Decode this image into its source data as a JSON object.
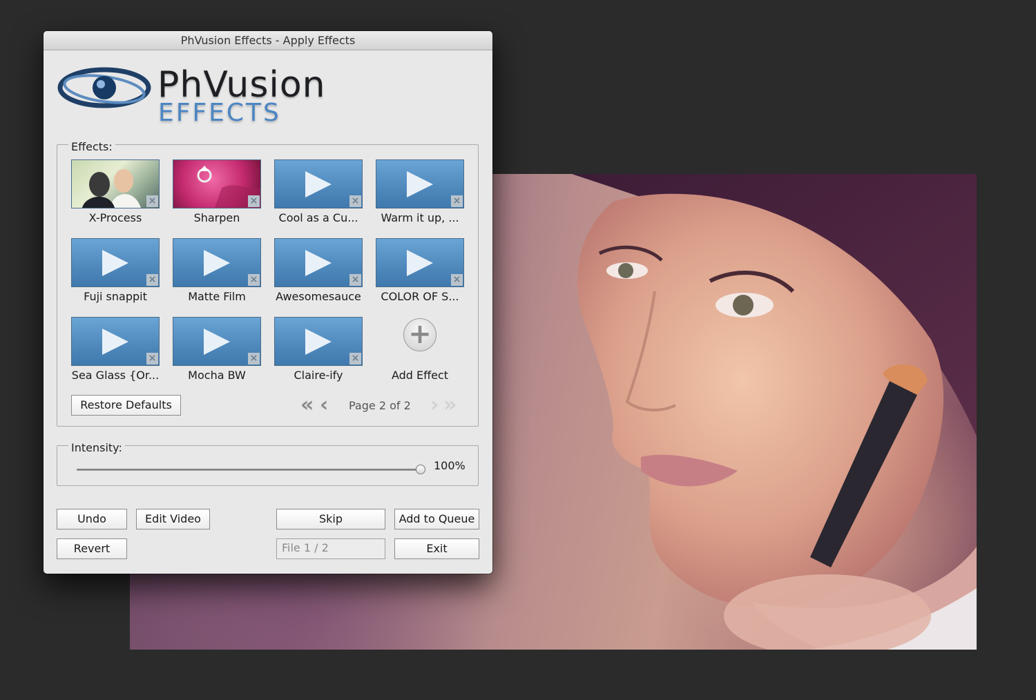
{
  "window": {
    "title": "PhVusion Effects - Apply Effects"
  },
  "logo": {
    "line1": "PhVusion",
    "line2": "EFFECTS"
  },
  "effects": {
    "group_label": "Effects:",
    "tiles": [
      {
        "label": "X-Process",
        "thumb": "photo-couple"
      },
      {
        "label": "Sharpen",
        "thumb": "photo-ring"
      },
      {
        "label": "Cool as a Cu...",
        "thumb": "play"
      },
      {
        "label": "Warm it up, ...",
        "thumb": "play"
      },
      {
        "label": "Fuji snappit",
        "thumb": "play"
      },
      {
        "label": "Matte Film",
        "thumb": "play"
      },
      {
        "label": "Awesomesauce",
        "thumb": "play"
      },
      {
        "label": "COLOR OF S...",
        "thumb": "play"
      },
      {
        "label": "Sea Glass {Or...",
        "thumb": "play"
      },
      {
        "label": "Mocha BW",
        "thumb": "play"
      },
      {
        "label": "Claire-ify",
        "thumb": "play"
      }
    ],
    "add_label": "Add Effect",
    "restore_label": "Restore Defaults",
    "page_text": "Page 2 of 2"
  },
  "intensity": {
    "group_label": "Intensity:",
    "value_text": "100%",
    "value": 1.0
  },
  "buttons": {
    "undo": "Undo",
    "edit_video": "Edit Video",
    "skip": "Skip",
    "add_to_queue": "Add to Queue",
    "revert": "Revert",
    "exit": "Exit"
  },
  "file_field": {
    "value": "File 1 / 2"
  },
  "colors": {
    "play_tile": "#5a94c8",
    "window_bg": "#e8e8e8",
    "logo_accent": "#4c86c3",
    "desktop_bg": "#2b2b2b"
  }
}
